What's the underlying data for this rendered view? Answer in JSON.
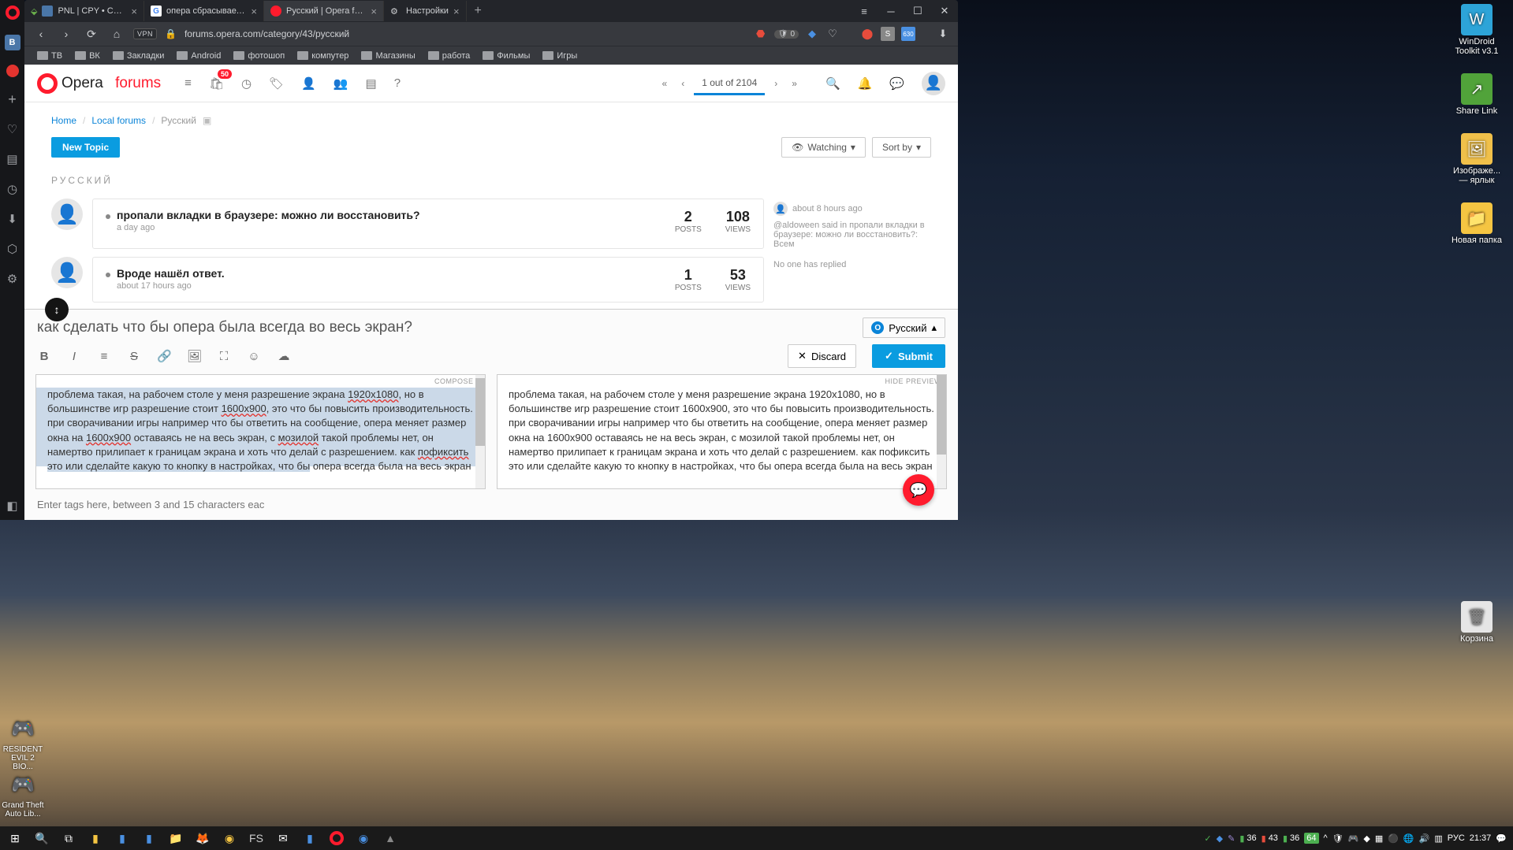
{
  "browser": {
    "tabs": [
      {
        "label": "PNL | CPY • CODEX | Crack...",
        "kind": "vk",
        "close": true
      },
      {
        "label": "опера сбрасывает разме...",
        "kind": "g",
        "close": true
      },
      {
        "label": "Русский | Opera forums",
        "kind": "opera",
        "close": true,
        "active": true
      },
      {
        "label": "Настройки",
        "kind": "gear",
        "close": true
      }
    ],
    "url": "forums.opera.com/category/43/русский",
    "vpn": "VPN",
    "addr_badge": "0",
    "bookmarks": [
      "ТВ",
      "ВК",
      "Закладки",
      "Android",
      "фотошоп",
      "компутер",
      "Магазины",
      "работа",
      "Фильмы",
      "Игры"
    ]
  },
  "desktop": {
    "icons": [
      {
        "label": "WinDroid Toolkit v3.1",
        "color": "blue",
        "glyph": "W"
      },
      {
        "label": "Share Link",
        "color": "green",
        "glyph": "↗"
      },
      {
        "label": "Изображе... — ярлык",
        "color": "img",
        "glyph": "🖼"
      },
      {
        "label": "Новая папка",
        "color": "folder",
        "glyph": "📁"
      },
      {
        "label": "Корзина",
        "color": "trash",
        "glyph": "🗑"
      }
    ],
    "left_icons": [
      {
        "label": "RESIDENT EVIL 2  BIO...",
        "glyph": "🎮"
      },
      {
        "label": "Grand Theft Auto Lib...",
        "glyph": "🎮"
      }
    ]
  },
  "forum": {
    "logo_a": "Opera",
    "logo_b": "forums",
    "badge_count": "50",
    "pager": "1 out of 2104",
    "breadcrumbs": {
      "home": "Home",
      "local": "Local forums",
      "current": "Русский"
    },
    "new_topic": "New Topic",
    "watching": "Watching",
    "sortby": "Sort by",
    "category": "РУССКИЙ",
    "topics": [
      {
        "title": "пропали вкладки в браузере: можно ли восстановить?",
        "time": "a day ago",
        "posts": "2",
        "posts_l": "POSTS",
        "views": "108",
        "views_l": "VIEWS",
        "side_time": "about 8 hours ago",
        "side_text": "@aldoween said in пропали вкладки в браузере: можно ли восстановить?: Всем"
      },
      {
        "title": "Вроде нашёл ответ.",
        "time": "about 17 hours ago",
        "posts": "1",
        "posts_l": "POSTS",
        "views": "53",
        "views_l": "VIEWS",
        "side_text": "No one has replied"
      }
    ]
  },
  "composer": {
    "title": "как сделать что бы опера была всегда во весь экран?",
    "category": "Русский",
    "discard": "Discard",
    "submit": "Submit",
    "compose_label": "COMPOSE ?",
    "preview_label": "HIDE PREVIEW",
    "text": "проблема такая, на рабочем столе у меня разрешение экрана 1920х1080, но в большинстве игр разрешение стоит 1600х900, это что бы повысить производительность. при сворачивании игры например что бы ответить на сообщение, опера меняет размер окна на 1600х900 оставаясь не на весь экран, с мозилой такой проблемы нет, он намертво прилипает к границам экрана и хоть что делай с разрешением. как пофиксить это или сделайте какую то кнопку в настройках, что бы опера всегда была на весь экран",
    "tags_placeholder": "Enter tags here, between 3 and 15 characters eac"
  },
  "taskbar": {
    "tray": {
      "t1": "36",
      "t2": "43",
      "t3": "36",
      "mem": "64",
      "lang": "РУС",
      "time": "21:37"
    }
  }
}
